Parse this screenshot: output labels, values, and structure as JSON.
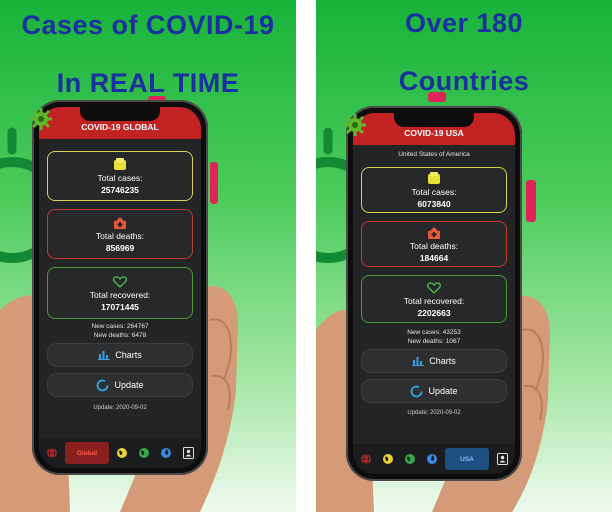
{
  "left": {
    "headline_line1": "Cases of COVID-19",
    "headline_line2": "In REAL TIME",
    "app_title": "COVID-19 GLOBAL",
    "cases_label": "Total cases:",
    "cases_value": "25746235",
    "deaths_label": "Total deaths:",
    "deaths_value": "856969",
    "recovered_label": "Total recovered:",
    "recovered_value": "17071445",
    "new_cases": "New cases: 264767",
    "new_deaths": "New deaths: 6478",
    "charts_label": "Charts",
    "update_label": "Update",
    "update_date": "Update: 2020-09-02",
    "selected_tab": "Global"
  },
  "right": {
    "headline_line1": "Over 180",
    "headline_line2": "Countries",
    "app_title": "COVID-19 USA",
    "country_name": "United States of America",
    "cases_label": "Total cases:",
    "cases_value": "6073840",
    "deaths_label": "Total deaths:",
    "deaths_value": "184664",
    "recovered_label": "Total recovered:",
    "recovered_value": "2202663",
    "new_cases": "New cases: 43253",
    "new_deaths": "New deaths: 1067",
    "charts_label": "Charts",
    "update_label": "Update",
    "update_date": "Update: 2020-09-02",
    "selected_tab": "USA"
  },
  "icons": {
    "cases": "fist-icon",
    "deaths": "hospital-icon",
    "recovered": "heart-icon",
    "charts": "bar-chart-icon",
    "update": "refresh-ring-icon",
    "settings": "virus-gear-icon",
    "nav": [
      "globe-icon",
      "world-yellow-icon",
      "world-green-icon",
      "world-blue-icon",
      "contact-book-icon"
    ]
  },
  "colors": {
    "background_gradient_top": "#17b33a",
    "headline": "#1b2fa0",
    "appbar": "#c32222",
    "screen": "#222426",
    "cases_border": "#d8d24a",
    "deaths_border": "#c23a34",
    "recovered_border": "#4a9a3a",
    "update_ring": "#2ea8e6",
    "charts_icon": "#3aa0e6",
    "global_tab": "#8a1f1f",
    "usa_tab": "#1d4f80"
  }
}
